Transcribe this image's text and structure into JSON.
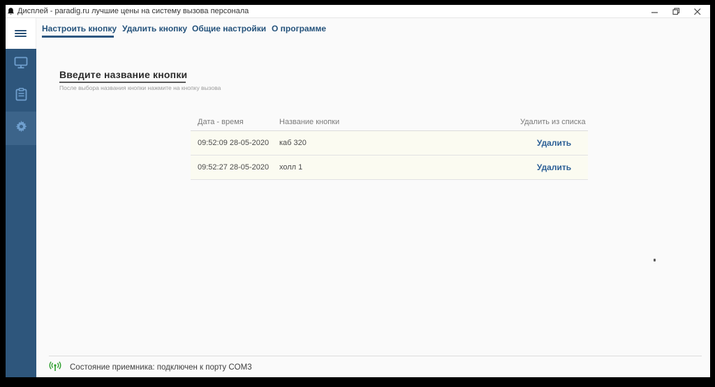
{
  "window": {
    "title": "Дисплей - paradig.ru лучшие цены на систему вызова персонала"
  },
  "tabs": [
    {
      "label": "Настроить кнопку",
      "active": true
    },
    {
      "label": "Удалить кнопку",
      "active": false
    },
    {
      "label": "Общие настройки",
      "active": false
    },
    {
      "label": "О программе",
      "active": false
    }
  ],
  "sidebar": {
    "items": [
      {
        "icon": "monitor-icon",
        "active": false
      },
      {
        "icon": "clipboard-icon",
        "active": false
      },
      {
        "icon": "gear-icon",
        "active": true
      }
    ]
  },
  "form": {
    "label": "Введите название кнопки",
    "helper": "После выбора названия кнопки нажмите на кнопку вызова"
  },
  "table": {
    "headers": [
      "Дата - время",
      "Название кнопки",
      "Удалить из списка"
    ],
    "rows": [
      {
        "datetime": "09:52:09 28-05-2020",
        "button_name": "каб 320",
        "action": "Удалить"
      },
      {
        "datetime": "09:52:27 28-05-2020",
        "button_name": "холл 1",
        "action": "Удалить"
      }
    ]
  },
  "statusbar": {
    "text": "Состояние приемника: подключен к порту COM3"
  },
  "colors": {
    "sidebar": "#2e567c",
    "sidebar_active": "#3c648a",
    "sidebar_icon": "#6f9fce",
    "tab_text": "#24527b",
    "tab_underline": "#2d5680",
    "delete_link": "#2d6096",
    "row_background": "#fbfbf1",
    "status_icon_green": "#2e9e2e",
    "frame": "#000000"
  }
}
